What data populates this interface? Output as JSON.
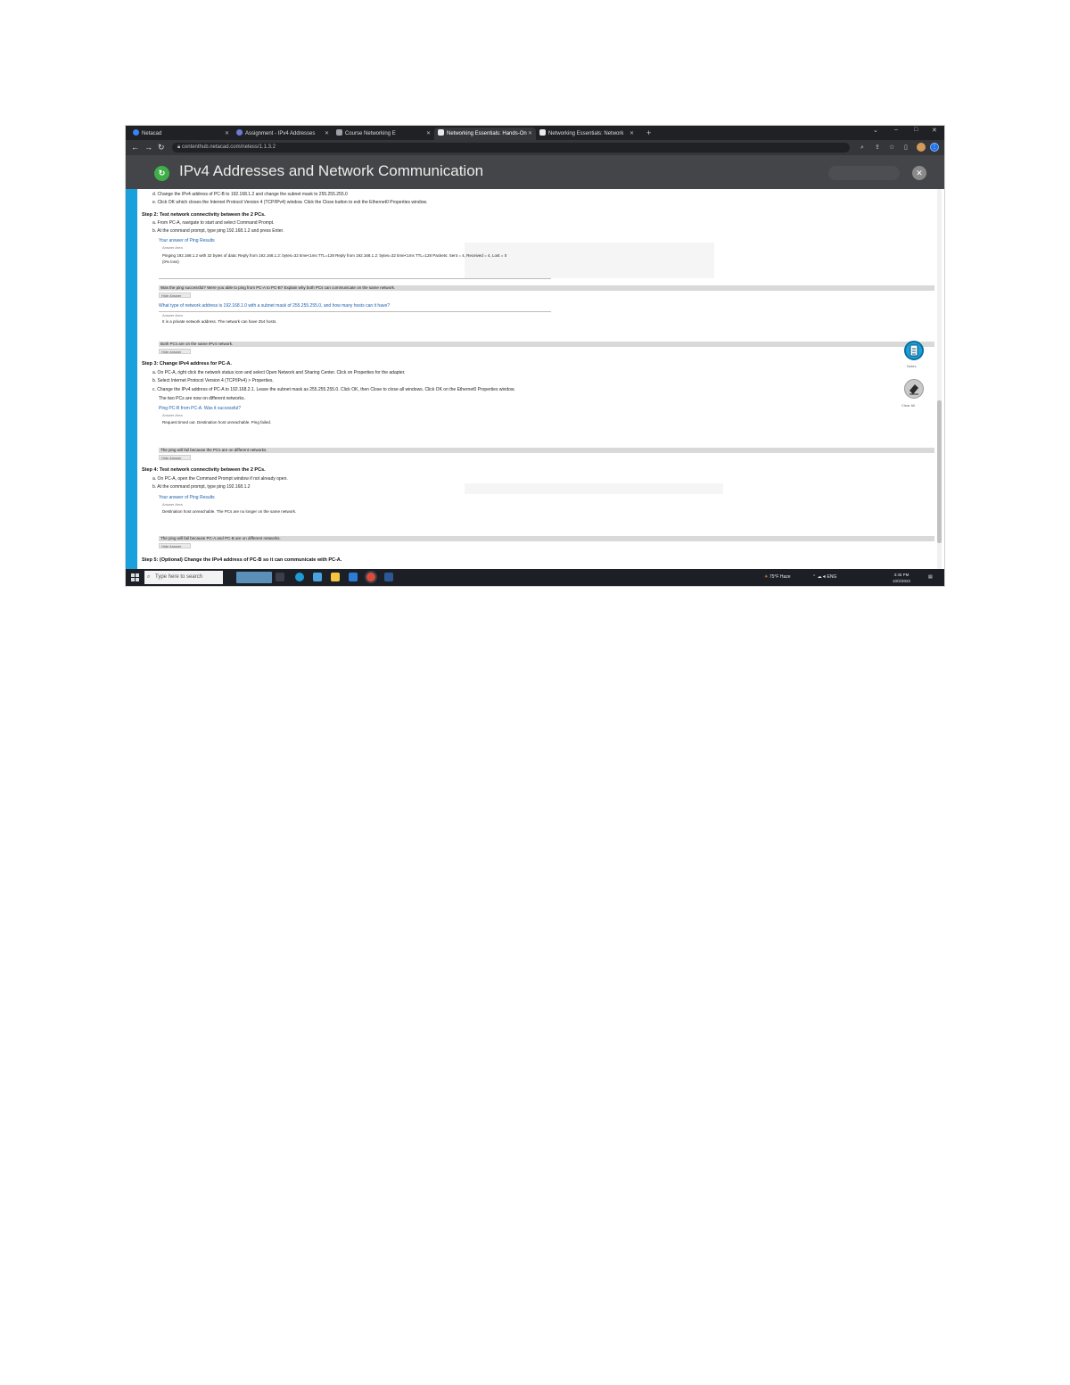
{
  "browser": {
    "tabs": [
      {
        "label": "Netacad"
      },
      {
        "label": "Assignment - IPv4 Addresses"
      },
      {
        "label": "Course Networking E"
      },
      {
        "label": "Networking Essentials: Hands-On"
      },
      {
        "label": "Networking Essentials: Network"
      }
    ],
    "new_tab": "+",
    "url": "contenthub.netacad.com/netess/1.1.3.2"
  },
  "app": {
    "title": "IPv4 Addresses and Network Communication",
    "close": "✕"
  },
  "content": {
    "line_top1": "d. Change the IPv4 address of PC-B to 192.168.1.2 and change the subnet mask to 255.255.255.0",
    "line_top2": "e. Click OK which closes the Internet Protocol Version 4 (TCP/IPv4) window. Click the Close button to exit the Ethernet0 Properties window.",
    "step2_title": "Step 2: Test network connectivity between the 2 PCs.",
    "step2_a": "a. From PC-A, navigate to start and select Command Prompt.",
    "step2_b": "b. At the command prompt, type ping 192.168.1.2 and press Enter.",
    "q1_label": "Your answer of Ping Results",
    "q1_sub": "Answer Area",
    "q1_answer": "Pinging 192.168.1.2 with 32 bytes of data: Reply from 192.168.1.2: bytes=32 time<1ms TTL=128 Reply from 192.168.1.2: bytes=32 time<1ms TTL=128 Packets: Sent = 4, Received = 4, Lost = 0",
    "q1_answer2": "(0% loss)",
    "bar1": "Was the ping successful? Were you able to ping from PC-A to PC-B? Explain why both PCs can communicate on the same network.",
    "btn1": "Hide Answer",
    "q2_label": "What type of network address is 192.168.1.0 with a subnet mask of 255.255.255.0, and how many hosts can it have?",
    "q2_sub": "Answer Area",
    "q2_answer": "It is a private network address. The network can have 254 hosts.",
    "bar2": "Both PCs are on the same IPv4 network.",
    "btn2": "Hide Answer",
    "step3_title": "Step 3: Change IPv4 address for PC-A.",
    "step3_a": "a. On PC-A, right click the network status icon and select Open Network and Sharing Center. Click on Properties for the adapter.",
    "step3_b": "b. Select Internet Protocol Version 4 (TCP/IPv4) > Properties.",
    "step3_c": "c. Change the IPv4 address of PC-A to 192.168.2.1. Leave the subnet mask as 255.255.255.0. Click OK, then Close to close all windows. Click OK on the Ethernet0 Properties window.",
    "step3_d": "The two PCs are now on different networks.",
    "q3_label": "Ping PC-B from PC-A. Was it successful?",
    "q3_sub": "Answer Area",
    "q3_answer": "Request timed out. Destination host unreachable. Ping failed.",
    "bar3": "The ping will fail because the PCs are on different networks.",
    "btn3": "Hide Answer",
    "step4_title": "Step 4: Test network connectivity between the 2 PCs.",
    "step4_a": "a. On PC-A, open the Command Prompt window if not already open.",
    "step4_b": "b. At the command prompt, type ping 192.168.1.2",
    "q4_label": "Your answer of Ping Results",
    "q4_sub": "Answer Area",
    "q4_answer": "Destination host unreachable. The PCs are no longer on the same network.",
    "bar4": "The ping will fail because PC-A and PC-B are on different networks.",
    "btn4": "Hide Answer",
    "step5_title": "Step 5: (Optional) Change the IPv4 address of PC-B so it can communicate with PC-A."
  },
  "side": {
    "notes_label": "Notes",
    "eraser_label": "Clear All"
  },
  "taskbar": {
    "search_placeholder": "Type here to search",
    "weather": "75°F Haze",
    "lang": "ENG",
    "time": "3:45 PM",
    "date": "10/2/2022"
  }
}
